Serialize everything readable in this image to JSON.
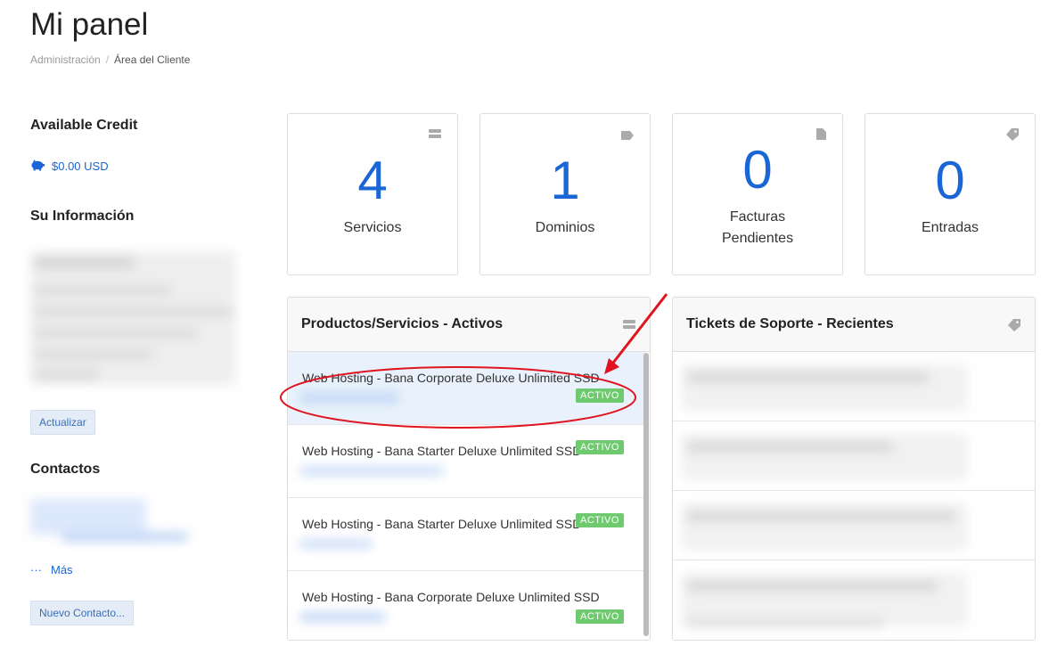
{
  "page": {
    "title": "Mi panel"
  },
  "breadcrumb": {
    "items": [
      "Administración",
      "Área del Cliente"
    ]
  },
  "sidebar": {
    "credit_title": "Available Credit",
    "credit_amount": "$0.00 USD",
    "info_title": "Su Información",
    "update_button": "Actualizar",
    "contacts_title": "Contactos",
    "more_label": "Más",
    "new_contact_button": "Nuevo Contacto..."
  },
  "stats": [
    {
      "value": "4",
      "label": "Servicios",
      "icon": "server-icon"
    },
    {
      "value": "1",
      "label": "Dominios",
      "icon": "tag-icon"
    },
    {
      "value": "0",
      "label": "Facturas Pendientes",
      "icon": "file-icon"
    },
    {
      "value": "0",
      "label": "Entradas",
      "icon": "ticket-icon"
    }
  ],
  "services_panel": {
    "title": "Productos/Servicios - Activos",
    "items": [
      {
        "name": "Web Hosting - Bana Corporate Deluxe Unlimited SSD",
        "status": "ACTIVO"
      },
      {
        "name": "Web Hosting - Bana Starter Deluxe Unlimited SSD",
        "status": "ACTIVO"
      },
      {
        "name": "Web Hosting - Bana Starter Deluxe Unlimited SSD",
        "status": "ACTIVO"
      },
      {
        "name": "Web Hosting - Bana Corporate Deluxe Unlimited SSD",
        "status": "ACTIVO"
      }
    ]
  },
  "tickets_panel": {
    "title": "Tickets de Soporte - Recientes"
  },
  "colors": {
    "accent": "#1a66d6",
    "active_badge": "#6fca6f",
    "annotation": "#e0141e"
  }
}
